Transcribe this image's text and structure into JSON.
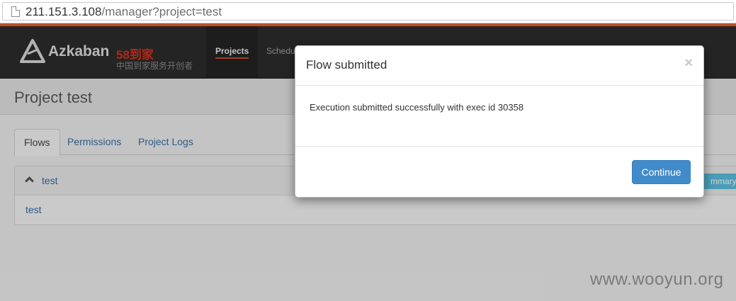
{
  "browser": {
    "url_host": "211.151.3.108",
    "url_path": "/manager?project=test"
  },
  "navbar": {
    "brand": "Azkaban",
    "brand_cn": "58到家",
    "brand_sub": "中国到家服务开创者",
    "items": [
      {
        "label": "Projects",
        "active": true
      },
      {
        "label": "Schedu",
        "active": false
      }
    ]
  },
  "page": {
    "title": "Project test"
  },
  "tabs": [
    {
      "label": "Flows",
      "active": true
    },
    {
      "label": "Permissions",
      "active": false
    },
    {
      "label": "Project Logs",
      "active": false
    }
  ],
  "flow_panel": {
    "title": "test",
    "summary_label": "mmary",
    "rows": [
      "test"
    ]
  },
  "modal": {
    "title": "Flow submitted",
    "close_glyph": "×",
    "message": "Execution submitted successfully with exec id 30358",
    "continue_label": "Continue"
  },
  "watermark": "www.wooyun.org",
  "colors": {
    "accent": "#c94a22",
    "navbar_bg": "#2d2d2d",
    "link": "#3a6fa8",
    "primary_button": "#428bca",
    "info_button": "#5bc0de",
    "brand_red": "#d9311c"
  }
}
